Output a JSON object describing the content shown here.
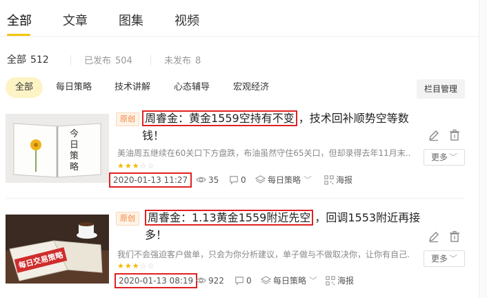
{
  "tabs": [
    {
      "label": "全部",
      "active": true
    },
    {
      "label": "文章",
      "active": false
    },
    {
      "label": "图集",
      "active": false
    },
    {
      "label": "视频",
      "active": false
    }
  ],
  "counts": {
    "all_label": "全部",
    "all_count": "512",
    "published_label": "已发布",
    "published_count": "504",
    "unpublished_label": "未发布",
    "unpublished_count": "8"
  },
  "filters": [
    "全部",
    "每日策略",
    "技术讲解",
    "心态辅导",
    "宏观经济"
  ],
  "manage_label": "栏目管理",
  "articles": [
    {
      "badge": "原创",
      "title_highlight": "周睿金：黄金1559空持有不变",
      "title_rest": "，技术回补顺势空等数钱！",
      "desc": "美油周五继续在60关口下方盘跌，布油虽然守住65关口，但却录得去年11月末...",
      "stars": 3,
      "time": "2020-01-13 11:27",
      "views": "35",
      "comments": "0",
      "category": "每日策略",
      "poster": "海报",
      "more": "更多",
      "thumb_text": "今日策略"
    },
    {
      "badge": "原创",
      "title_highlight": "周睿金：1.13黄金1559附近先空",
      "title_rest": "，回调1553附近再接多！",
      "desc": "我们不会强迫客户做单，只会为你分析建议，单子做与不做取决你，让你有自己...",
      "stars": 3,
      "time": "2020-01-13 08:19",
      "views": "922",
      "comments": "0",
      "category": "每日策略",
      "poster": "海报",
      "more": "更多",
      "thumb_text": "每日交易策略"
    }
  ],
  "colors": {
    "accent": "#f5c400",
    "highlight_border": "#e02020",
    "badge": "#f0833a"
  }
}
